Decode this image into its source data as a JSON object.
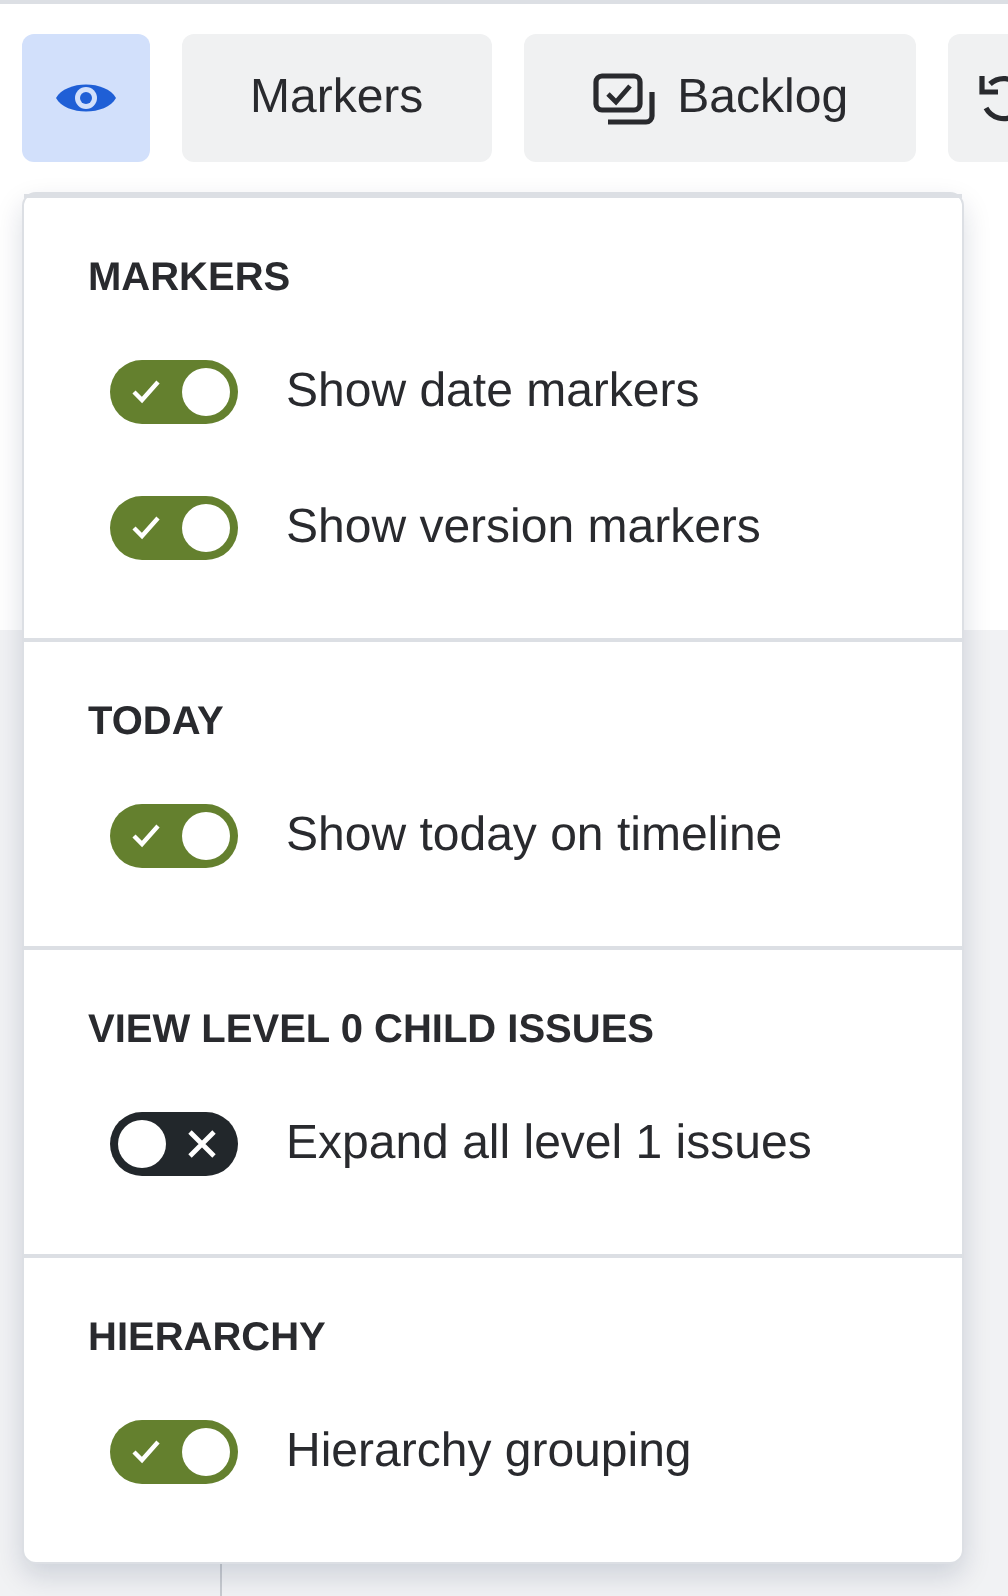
{
  "toolbar": [
    {
      "kind": "eye",
      "selected": true
    },
    {
      "kind": "text",
      "label": "Markers",
      "selected": false
    },
    {
      "kind": "backlog",
      "label": "Backlog",
      "selected": false
    },
    {
      "kind": "undo",
      "selected": false
    }
  ],
  "popup": {
    "sections": [
      {
        "title": "MARKERS",
        "toggles": [
          {
            "label": "Show date markers",
            "on": true
          },
          {
            "label": "Show version markers",
            "on": true
          }
        ]
      },
      {
        "title": "TODAY",
        "toggles": [
          {
            "label": "Show today on timeline",
            "on": true
          }
        ]
      },
      {
        "title": "VIEW LEVEL 0 CHILD ISSUES",
        "toggles": [
          {
            "label": "Expand all level 1 issues",
            "on": false
          }
        ]
      },
      {
        "title": "HIERARCHY",
        "toggles": [
          {
            "label": "Hierarchy grouping",
            "on": true
          }
        ]
      }
    ]
  }
}
